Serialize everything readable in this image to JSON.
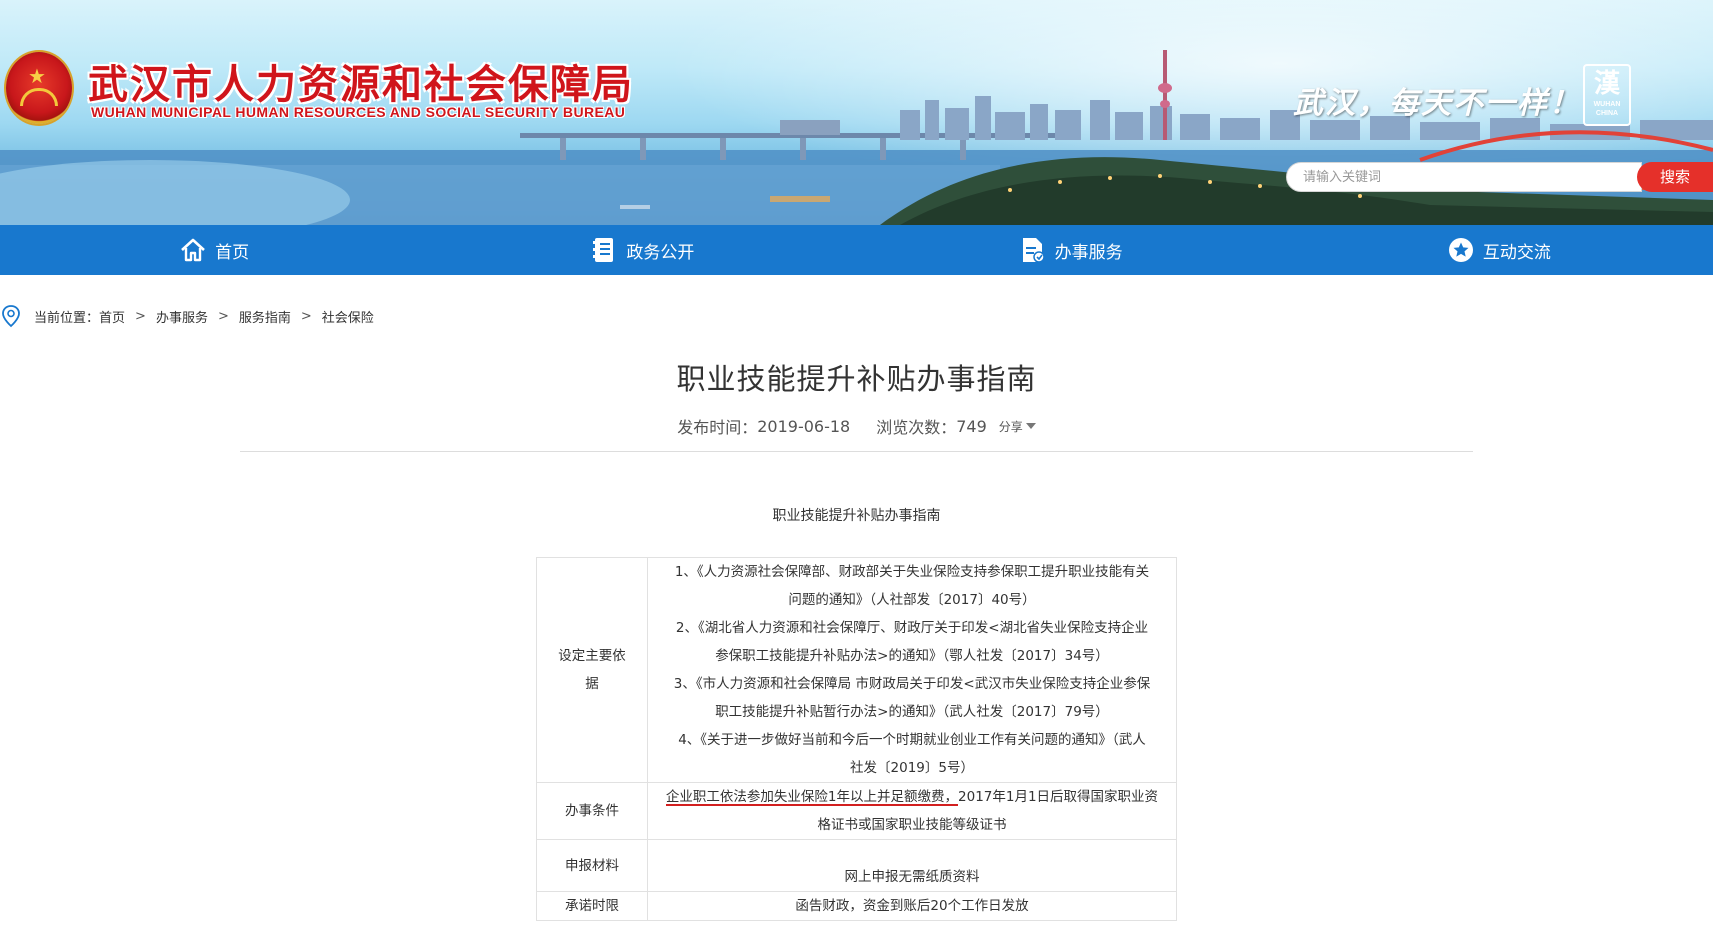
{
  "header": {
    "title": "武汉市人力资源和社会保障局",
    "subtitle": "WUHAN MUNICIPAL HUMAN RESOURCES AND SOCIAL SECURITY BUREAU",
    "slogan": "武汉，每天不一样！",
    "city_mark_glyph": "漢",
    "city_mark_label": "WUHAN\nCHINA",
    "search": {
      "placeholder": "请输入关键词",
      "button": "搜索"
    }
  },
  "nav": {
    "items": [
      {
        "label": "首页",
        "icon": "home-icon"
      },
      {
        "label": "政务公开",
        "icon": "document-list-icon"
      },
      {
        "label": "办事服务",
        "icon": "file-service-icon"
      },
      {
        "label": "互动交流",
        "icon": "star-badge-icon"
      }
    ]
  },
  "breadcrumb": {
    "prefix": "当前位置：",
    "items": [
      "首页",
      "办事服务",
      "服务指南",
      "社会保险"
    ],
    "separator": ">"
  },
  "article": {
    "title": "职业技能提升补贴办事指南",
    "publish_label": "发布时间：",
    "publish_date": "2019-06-18",
    "views_label": "浏览次数：",
    "views": "749",
    "share": "分享",
    "heading": "职业技能提升补贴办事指南"
  },
  "table": {
    "rows": [
      {
        "label": "设定主要依据",
        "lines": [
          "1、《人力资源社会保障部、财政部关于失业保险支持参保职工提升职业技能有关",
          "问题的通知》（人社部发〔2017〕40号）",
          "2、《湖北省人力资源和社会保障厅、财政厅关于印发<湖北省失业保险支持企业",
          "参保职工技能提升补贴办法>的通知》（鄂人社发〔2017〕34号）",
          "3、《市人力资源和社会保障局 市财政局关于印发<武汉市失业保险支持企业参保",
          "职工技能提升补贴暂行办法>的通知》（武人社发〔2017〕79号）",
          "4、《关于进一步做好当前和今后一个时期就业创业工作有关问题的通知》（武人",
          "社发〔2019〕5号）"
        ]
      },
      {
        "label": "办事条件",
        "underlined": "企业职工依法参加失业保险1年以上并足额缴费，",
        "rest_line1": "2017年1月1日后取得国家职业资",
        "line2": "格证书或国家职业技能等级证书"
      },
      {
        "label": "申报材料",
        "value": "网上申报无需纸质资料"
      },
      {
        "label": "承诺时限",
        "value": "函告财政，资金到账后20个工作日发放"
      }
    ]
  },
  "colors": {
    "brand_red": "#d0151b",
    "nav_blue": "#1878ce",
    "search_red": "#e5302a",
    "annotation_red": "#d21f1f"
  }
}
